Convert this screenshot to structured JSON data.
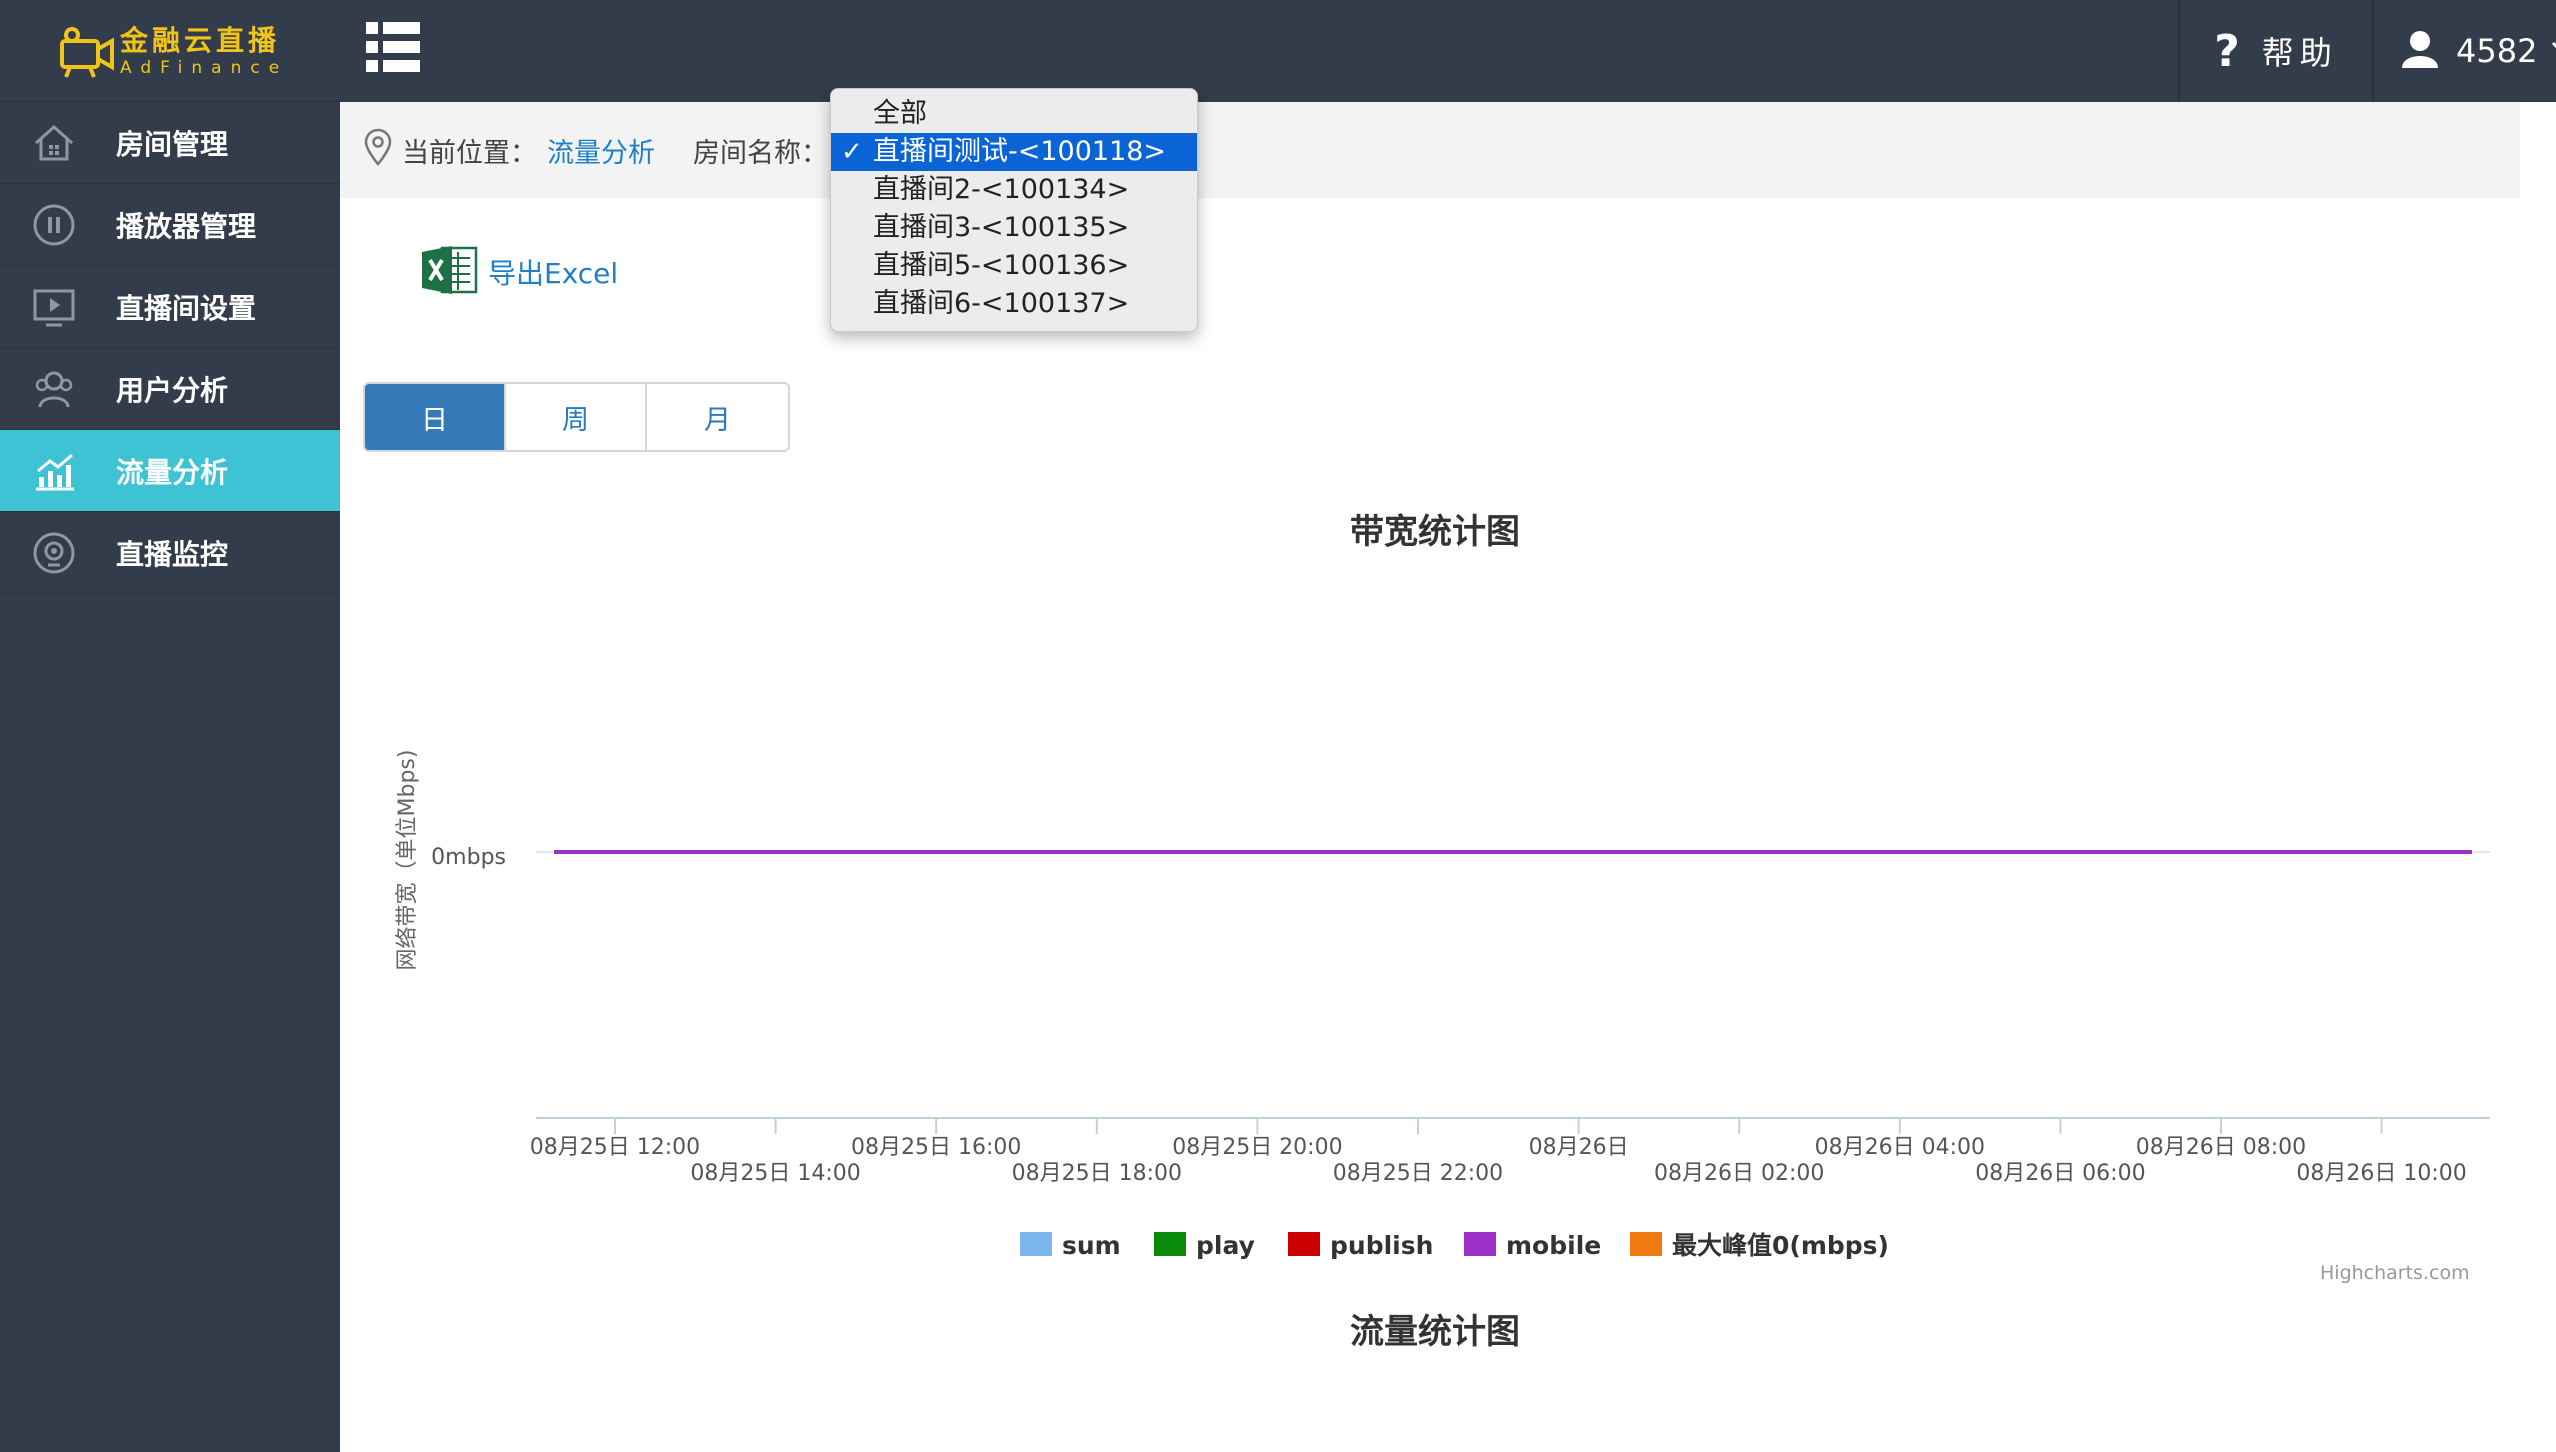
{
  "app": {
    "logo_cn": "金融云直播",
    "logo_en": "AdFinance"
  },
  "sidebar": {
    "items": [
      {
        "label": "房间管理",
        "icon": "home-icon",
        "active": false
      },
      {
        "label": "播放器管理",
        "icon": "pause-circle-icon",
        "active": false
      },
      {
        "label": "直播间设置",
        "icon": "play-screen-icon",
        "active": false
      },
      {
        "label": "用户分析",
        "icon": "users-icon",
        "active": false
      },
      {
        "label": "流量分析",
        "icon": "bar-chart-icon",
        "active": true
      },
      {
        "label": "直播监控",
        "icon": "monitor-eye-icon",
        "active": false
      }
    ]
  },
  "topbar": {
    "help_label": "帮助",
    "user_name": "4582"
  },
  "breadcrumb": {
    "current_label": "当前位置：",
    "current_page": "流量分析",
    "room_label": "房间名称："
  },
  "room_dropdown": {
    "options": [
      "全部",
      "直播间测试-<100118>",
      "直播间2-<100134>",
      "直播间3-<100135>",
      "直播间5-<100136>",
      "直播间6-<100137>"
    ],
    "selected_index": 1
  },
  "export": {
    "label": "导出Excel"
  },
  "period_tabs": {
    "items": [
      "日",
      "周",
      "月"
    ],
    "active_index": 0
  },
  "chart_data": {
    "type": "line",
    "title": "带宽统计图",
    "ylabel": "网络带宽（单位Mbps)",
    "y_tick_labels": [
      "0mbps"
    ],
    "x_tick_labels": [
      "08月25日 12:00",
      "08月25日 14:00",
      "08月25日 16:00",
      "08月25日 18:00",
      "08月25日 20:00",
      "08月25日 22:00",
      "08月26日",
      "08月26日 02:00",
      "08月26日 04:00",
      "08月26日 06:00",
      "08月26日 08:00",
      "08月26日 10:00"
    ],
    "series": [
      {
        "name": "sum",
        "color": "#7cb5ec",
        "values": [
          0,
          0,
          0,
          0,
          0,
          0,
          0,
          0,
          0,
          0,
          0,
          0
        ]
      },
      {
        "name": "play",
        "color": "#0a8a0a",
        "values": [
          0,
          0,
          0,
          0,
          0,
          0,
          0,
          0,
          0,
          0,
          0,
          0
        ]
      },
      {
        "name": "publish",
        "color": "#cc0000",
        "values": [
          0,
          0,
          0,
          0,
          0,
          0,
          0,
          0,
          0,
          0,
          0,
          0
        ]
      },
      {
        "name": "mobile",
        "color": "#9b30c8",
        "values": [
          0,
          0,
          0,
          0,
          0,
          0,
          0,
          0,
          0,
          0,
          0,
          0
        ]
      },
      {
        "name": "最大峰值0(mbps)",
        "color": "#f07a10",
        "values": [
          0,
          0,
          0,
          0,
          0,
          0,
          0,
          0,
          0,
          0,
          0,
          0
        ]
      }
    ],
    "ylim": [
      0,
      0
    ],
    "grid": true,
    "legend": "bottom-center"
  },
  "credits": "Highcharts.com",
  "chart2": {
    "title": "流量统计图"
  }
}
